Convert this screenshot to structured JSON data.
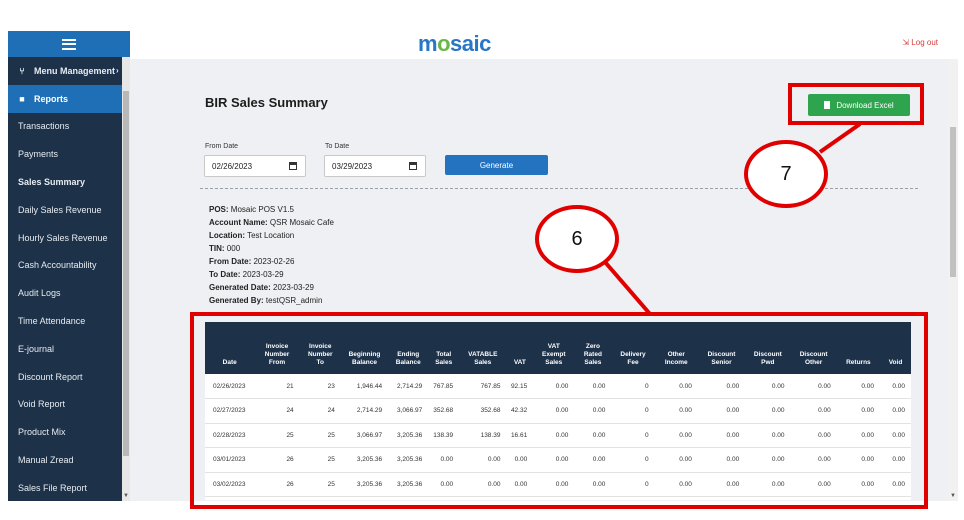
{
  "sidebar": {
    "items": [
      {
        "label": "Menu Management",
        "icon": "fork-knife-icon",
        "style": "bold",
        "arrow": "›"
      },
      {
        "label": "Reports",
        "icon": "document-icon",
        "style": "active"
      },
      {
        "label": "Transactions"
      },
      {
        "label": "Payments"
      },
      {
        "label": "Sales Summary",
        "style": "bold"
      },
      {
        "label": "Daily Sales Revenue"
      },
      {
        "label": "Hourly Sales Revenue"
      },
      {
        "label": "Cash Accountability"
      },
      {
        "label": "Audit Logs"
      },
      {
        "label": "Time Attendance"
      },
      {
        "label": "E-journal"
      },
      {
        "label": "Discount Report"
      },
      {
        "label": "Void Report"
      },
      {
        "label": "Product Mix"
      },
      {
        "label": "Manual Zread"
      },
      {
        "label": "Sales File Report"
      }
    ]
  },
  "header": {
    "logo_start": "m",
    "logo_o": "o",
    "logo_end": "saic",
    "logout_label": "Log out"
  },
  "page": {
    "title": "BIR Sales Summary",
    "download_label": "Download Excel",
    "from_date_label": "From Date",
    "to_date_label": "To Date",
    "from_date_value": "02/26/2023",
    "to_date_value": "03/29/2023",
    "generate_label": "Generate"
  },
  "info": [
    {
      "label": "POS:",
      "value": "Mosaic POS V1.5"
    },
    {
      "label": "Account Name:",
      "value": "QSR Mosaic Cafe"
    },
    {
      "label": "Location:",
      "value": "Test Location"
    },
    {
      "label": "TIN:",
      "value": "000"
    },
    {
      "label": "From Date:",
      "value": "2023-02-26"
    },
    {
      "label": "To Date:",
      "value": "2023-03-29"
    },
    {
      "label": "Generated Date:",
      "value": "2023-03-29"
    },
    {
      "label": "Generated By:",
      "value": "testQSR_admin"
    }
  ],
  "table": {
    "headers": [
      [
        "Date"
      ],
      [
        "Invoice",
        "Number",
        "From"
      ],
      [
        "Invoice",
        "Number",
        "To"
      ],
      [
        "Beginning",
        "Balance"
      ],
      [
        "Ending",
        "Balance"
      ],
      [
        "Total",
        "Sales"
      ],
      [
        "VATABLE",
        "Sales"
      ],
      [
        "VAT"
      ],
      [
        "VAT",
        "Exempt",
        "Sales"
      ],
      [
        "Zero",
        "Rated",
        "Sales"
      ],
      [
        "Delivery",
        "Fee"
      ],
      [
        "Other",
        "Income"
      ],
      [
        "Discount",
        "Senior"
      ],
      [
        "Discount",
        "Pwd"
      ],
      [
        "Discount",
        "Other"
      ],
      [
        "Returns"
      ],
      [
        "Void"
      ]
    ],
    "rows": [
      [
        "02/26/2023",
        "21",
        "23",
        "1,946.44",
        "2,714.29",
        "767.85",
        "767.85",
        "92.15",
        "0.00",
        "0.00",
        "0",
        "0.00",
        "0.00",
        "0.00",
        "0.00",
        "0.00",
        "0.00"
      ],
      [
        "02/27/2023",
        "24",
        "24",
        "2,714.29",
        "3,066.97",
        "352.68",
        "352.68",
        "42.32",
        "0.00",
        "0.00",
        "0",
        "0.00",
        "0.00",
        "0.00",
        "0.00",
        "0.00",
        "0.00"
      ],
      [
        "02/28/2023",
        "25",
        "25",
        "3,066.97",
        "3,205.36",
        "138.39",
        "138.39",
        "16.61",
        "0.00",
        "0.00",
        "0",
        "0.00",
        "0.00",
        "0.00",
        "0.00",
        "0.00",
        "0.00"
      ],
      [
        "03/01/2023",
        "26",
        "25",
        "3,205.36",
        "3,205.36",
        "0.00",
        "0.00",
        "0.00",
        "0.00",
        "0.00",
        "0",
        "0.00",
        "0.00",
        "0.00",
        "0.00",
        "0.00",
        "0.00"
      ],
      [
        "03/02/2023",
        "26",
        "25",
        "3,205.36",
        "3,205.36",
        "0.00",
        "0.00",
        "0.00",
        "0.00",
        "0.00",
        "0",
        "0.00",
        "0.00",
        "0.00",
        "0.00",
        "0.00",
        "0.00"
      ]
    ]
  },
  "annotations": {
    "callout_table": "6",
    "callout_download": "7",
    "color": "#e00000"
  }
}
